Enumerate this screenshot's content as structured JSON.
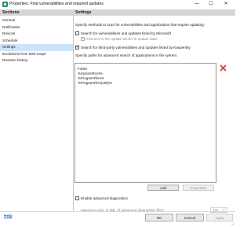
{
  "window": {
    "title": "Properties: Find vulnerabilities and required updates",
    "minimize_glyph": "—",
    "maximize_glyph": "☐",
    "close_glyph": "✕"
  },
  "sidebar": {
    "header": "Sections",
    "items": [
      {
        "label": "General",
        "selected": false
      },
      {
        "label": "Notification",
        "selected": false
      },
      {
        "label": "Devices",
        "selected": false
      },
      {
        "label": "Schedule",
        "selected": false
      },
      {
        "label": "Settings",
        "selected": true
      },
      {
        "label": "Exclusions from task scope",
        "selected": false
      },
      {
        "label": "Revision history",
        "selected": false
      }
    ]
  },
  "settings": {
    "header": "Settings",
    "intro": "Specify methods to scan for vulnerabilities and applications that require updating:",
    "scan_microsoft": {
      "label": "Search for vulnerabilities and updates listed by Microsoft",
      "checked": false
    },
    "connect_update_server": {
      "label": "Connect to the update server to update data",
      "checked": true,
      "disabled": true
    },
    "scan_third_party": {
      "label": "Search for third-party vulnerabilities and updates listed by Kaspersky",
      "checked": true
    },
    "paths_caption": "Specify paths for advanced search of applications in file system:",
    "paths_table": {
      "column": "Folder",
      "rows": [
        "%SystemRoot%",
        "%ProgramFiles%",
        "%ProgramFiles(x86)%"
      ]
    },
    "delete_icon": "red-x-delete-icon",
    "add_button": "Add",
    "properties_button": "Properties",
    "advanced_diagnostics": {
      "label": "Enable advanced diagnostics",
      "checked": false
    },
    "max_size_label": "Maximum size, in MB, of advanced diagnostics files:",
    "max_size_value": "100"
  },
  "footer": {
    "help_link": "Help",
    "ok_button": "OK",
    "cancel_button": "Cancel",
    "apply_button": "Apply"
  },
  "colors": {
    "header_gray": "#d6d6d6",
    "selected_nav": "#cfe4f7",
    "delete_red": "#d9342b",
    "link_blue": "#1f5fbf"
  }
}
